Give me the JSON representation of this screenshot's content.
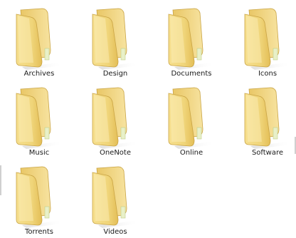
{
  "folders": [
    {
      "name": "Archives"
    },
    {
      "name": "Design"
    },
    {
      "name": "Documents"
    },
    {
      "name": "Icons"
    },
    {
      "name": "Music"
    },
    {
      "name": "OneNote"
    },
    {
      "name": "Online"
    },
    {
      "name": "Software"
    },
    {
      "name": "Torrents"
    },
    {
      "name": "Videos"
    }
  ],
  "colors": {
    "background": "#ffffff",
    "label": "#1a1a1a",
    "folder_front": "#f2d77f",
    "folder_back": "#e6c465",
    "folder_edge": "#c9a445"
  },
  "icon": "folder-icon"
}
